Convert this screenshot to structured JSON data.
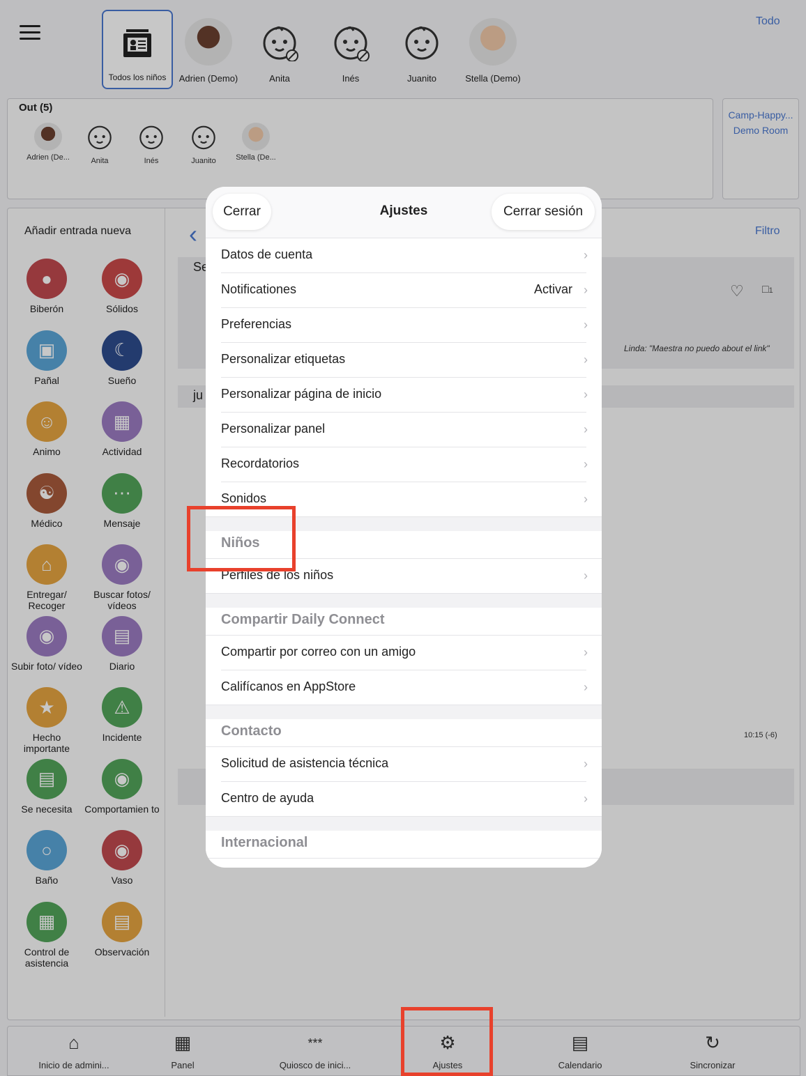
{
  "header": {
    "todo_label": "Todo",
    "children": [
      {
        "name": "Todos los niños",
        "kind": "all",
        "selected": true
      },
      {
        "name": "Adrien (Demo)",
        "kind": "photo"
      },
      {
        "name": "Anita",
        "kind": "face",
        "no_photo": true
      },
      {
        "name": "Inés",
        "kind": "face",
        "no_photo": true
      },
      {
        "name": "Juanito",
        "kind": "face"
      },
      {
        "name": "Stella (Demo)",
        "kind": "photo"
      }
    ]
  },
  "out_panel": {
    "title": "Out (5)",
    "children": [
      "Adrien (De...",
      "Anita",
      "Inés",
      "Juanito",
      "Stella (De..."
    ]
  },
  "room": {
    "line1": "Camp-Happy...",
    "line2": "Demo Room"
  },
  "left_panel": {
    "title": "Añadir entrada nueva",
    "entries": [
      {
        "label": "Biberón",
        "color": "#c0494f"
      },
      {
        "label": "Sólidos",
        "color": "#c94a4a"
      },
      {
        "label": "Pañal",
        "color": "#5aa6d8"
      },
      {
        "label": "Sueño",
        "color": "#2d4c8e"
      },
      {
        "label": "Animo",
        "color": "#e6a440"
      },
      {
        "label": "Actividad",
        "color": "#9b7bc2"
      },
      {
        "label": "Médico",
        "color": "#a85a3c"
      },
      {
        "label": "Mensaje",
        "color": "#52a45a"
      },
      {
        "label": "Entregar/ Recoger",
        "color": "#e6a440"
      },
      {
        "label": "Buscar fotos/ vídeos",
        "color": "#9b7bc2"
      },
      {
        "label": "Subir foto/ vídeo",
        "color": "#9b7bc2"
      },
      {
        "label": "Diario",
        "color": "#9b7bc2"
      },
      {
        "label": "Hecho importante",
        "color": "#e6a440"
      },
      {
        "label": "Incidente",
        "color": "#52a45a"
      },
      {
        "label": "Se necesita",
        "color": "#52a45a"
      },
      {
        "label": "Comportamien to",
        "color": "#52a45a"
      },
      {
        "label": "Baño",
        "color": "#5aa6d8"
      },
      {
        "label": "Vaso",
        "color": "#c0494f"
      },
      {
        "label": "Control de asistencia",
        "color": "#52a45a"
      },
      {
        "label": "Observación",
        "color": "#e6a440"
      }
    ]
  },
  "feed": {
    "filter_label": "Filtro",
    "row1_prefix": "Se",
    "row2_prefix": "ju",
    "comment": "Linda: \"Maestra no puedo about el link\"",
    "comment_count": "1",
    "time": "10:15 (-6)"
  },
  "modal": {
    "title": "Ajustes",
    "close_label": "Cerrar",
    "logout_label": "Cerrar sesión",
    "rows_account": [
      {
        "label": "Datos de cuenta",
        "value": ""
      },
      {
        "label": "Notificationes",
        "value": "Activar"
      },
      {
        "label": "Preferencias",
        "value": ""
      },
      {
        "label": "Personalizar etiquetas",
        "value": ""
      },
      {
        "label": "Personalizar página de inicio",
        "value": ""
      },
      {
        "label": "Personalizar panel",
        "value": ""
      },
      {
        "label": "Recordatorios",
        "value": ""
      },
      {
        "label": "Sonidos",
        "value": ""
      }
    ],
    "section_children": "Niños",
    "rows_children": [
      {
        "label": "Perfiles de los niños"
      }
    ],
    "section_share": "Compartir Daily Connect",
    "rows_share": [
      {
        "label": "Compartir por correo con un amigo"
      },
      {
        "label": "Califícanos en AppStore"
      }
    ],
    "section_contact": "Contacto",
    "rows_contact": [
      {
        "label": "Solicitud de asistencia técnica"
      },
      {
        "label": "Centro de ayuda"
      }
    ],
    "section_intl": "Internacional"
  },
  "tabbar": {
    "tabs": [
      {
        "label": "Inicio de admini...",
        "icon": "home-icon"
      },
      {
        "label": "Panel",
        "icon": "grid-icon"
      },
      {
        "label": "Quiosco de inici...",
        "icon": "keypad-icon"
      },
      {
        "label": "Ajustes",
        "icon": "gear-icon"
      },
      {
        "label": "Calendario",
        "icon": "calendar-icon"
      },
      {
        "label": "Sincronizar",
        "icon": "sync-icon"
      }
    ]
  },
  "colors": {
    "accent": "#4a78d0",
    "highlight": "#e8412c"
  }
}
